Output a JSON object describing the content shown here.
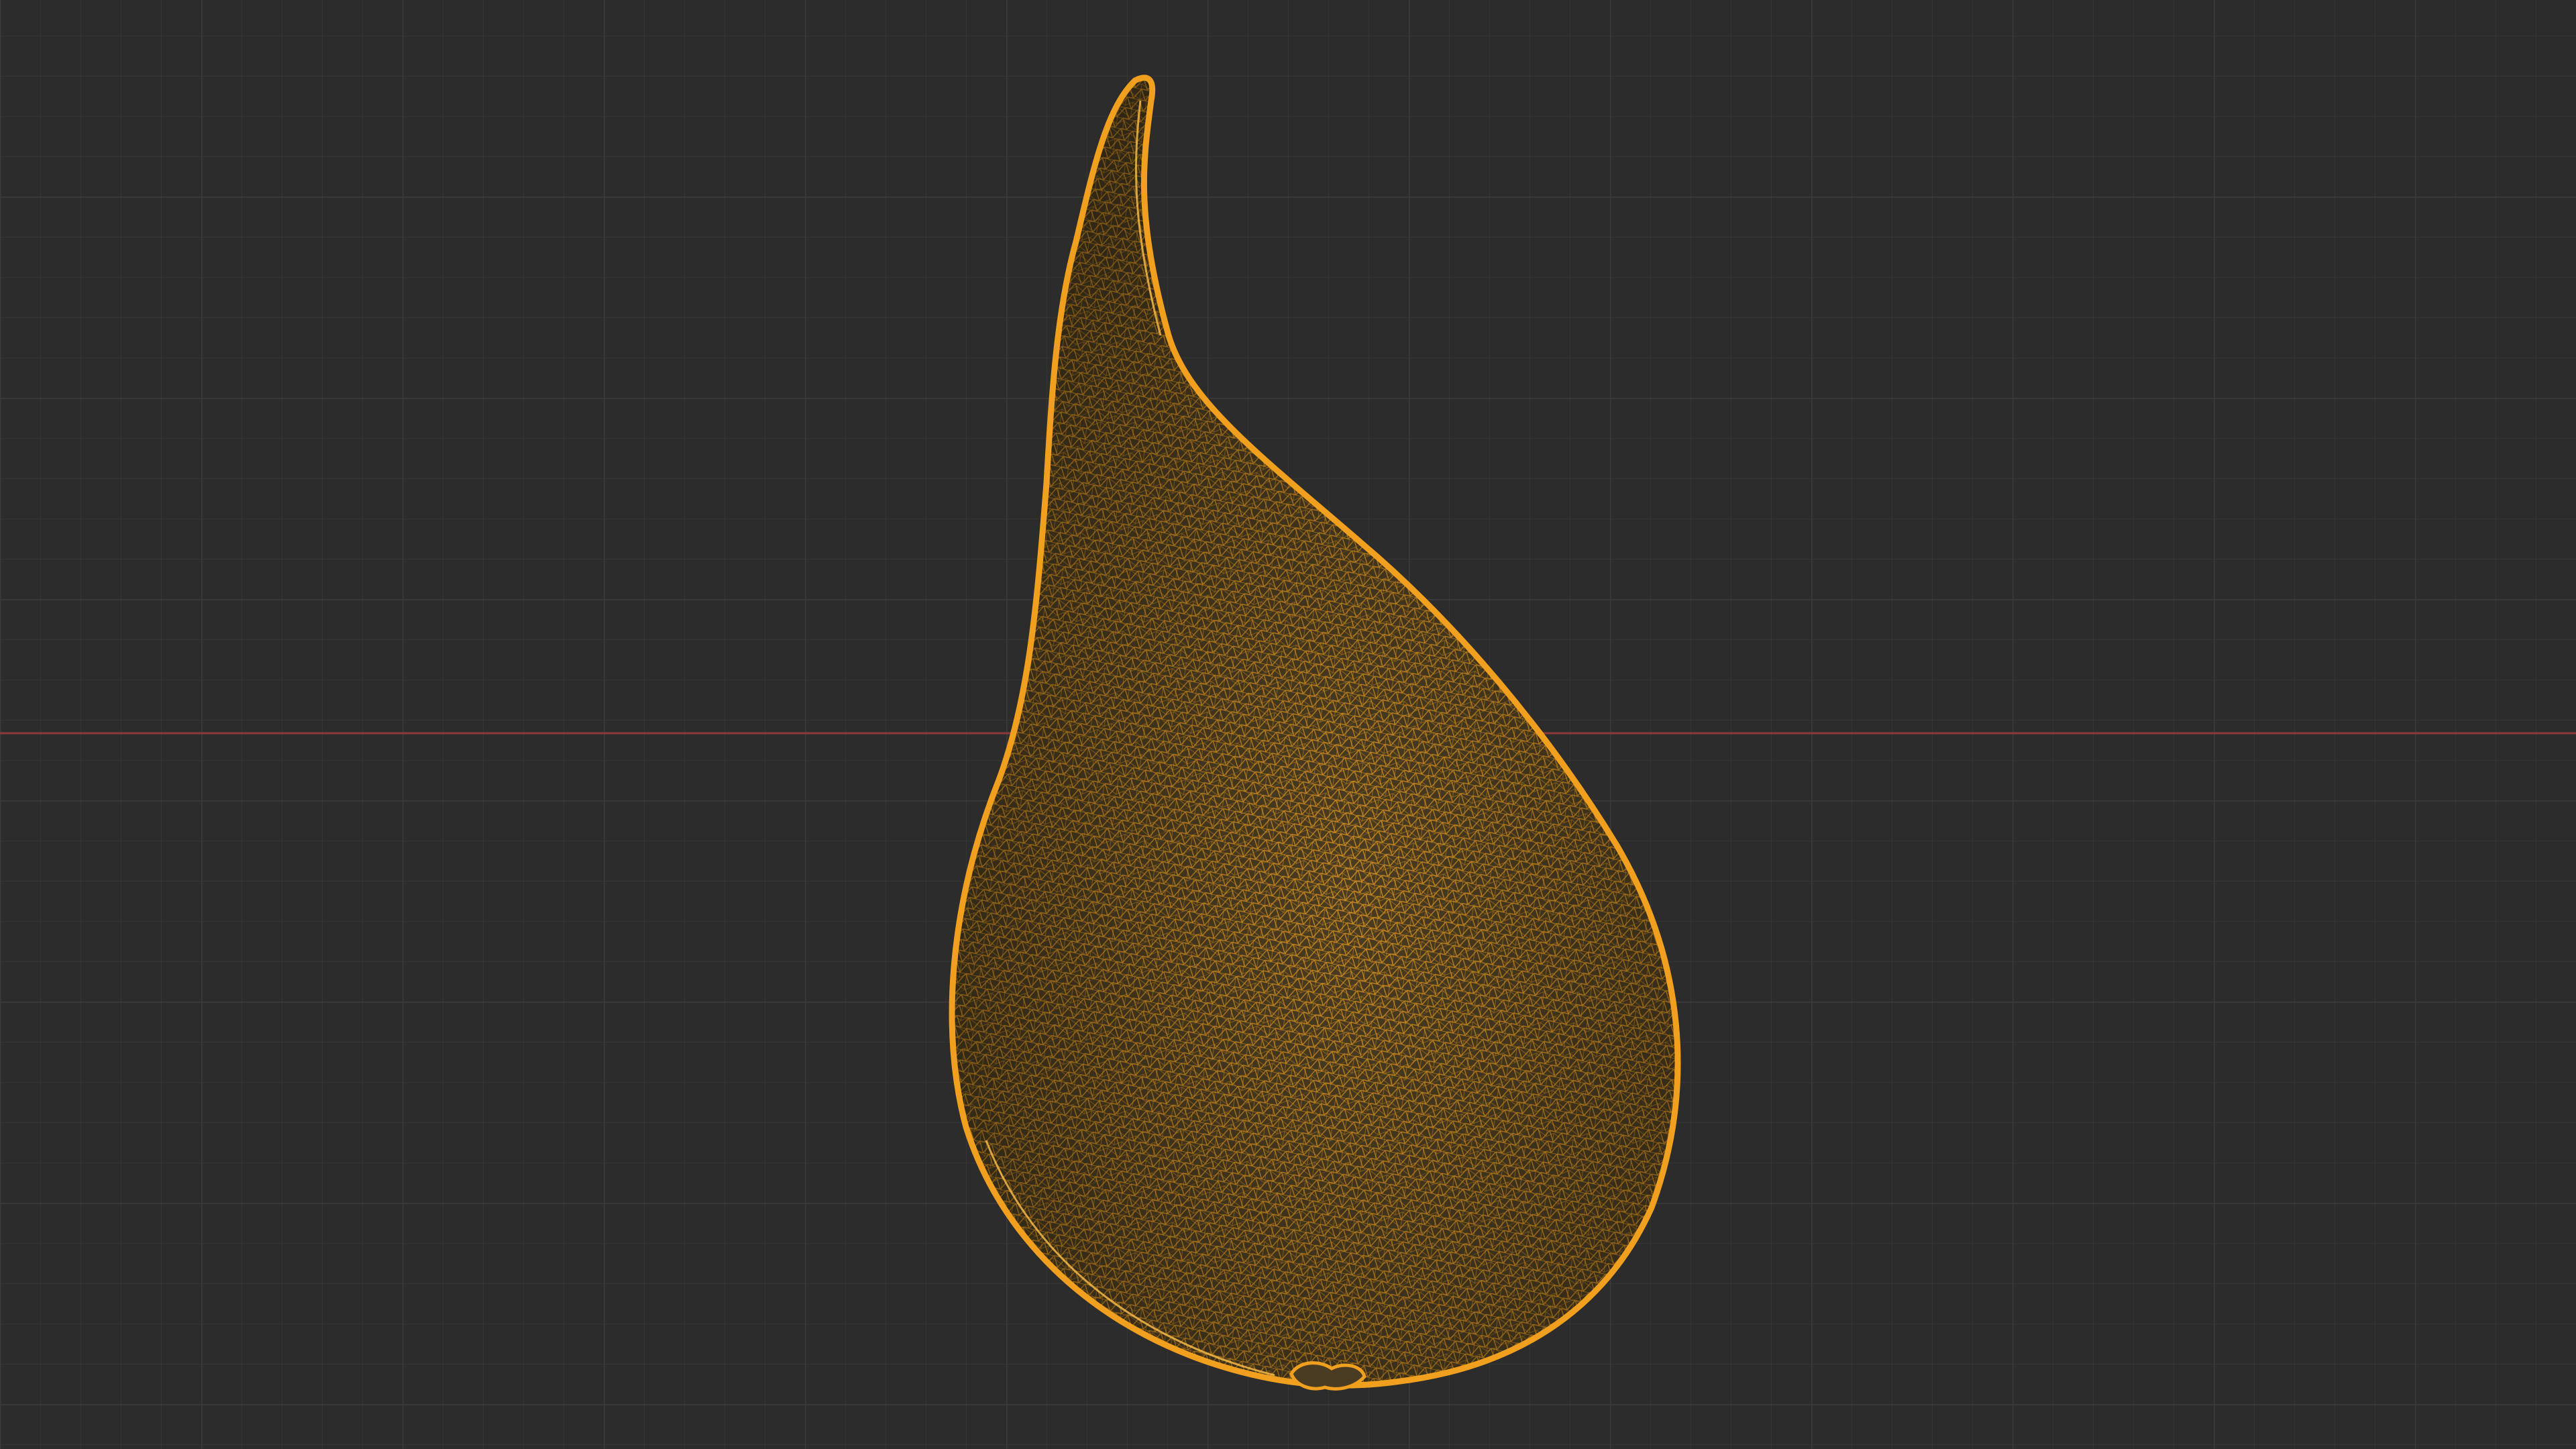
{
  "viewport": {
    "mode": "wireframe",
    "view": "orthographic"
  },
  "mesh": {
    "name": "",
    "selected": true,
    "wire_color": "#f0a01e",
    "fill_color": "#4a3c22"
  },
  "scene": {
    "background_color": "#2c2c2c",
    "grid_minor_color": "#353535",
    "grid_major_color": "#3b3b3b",
    "x_axis_color": "#8a3a3a"
  },
  "icons": []
}
